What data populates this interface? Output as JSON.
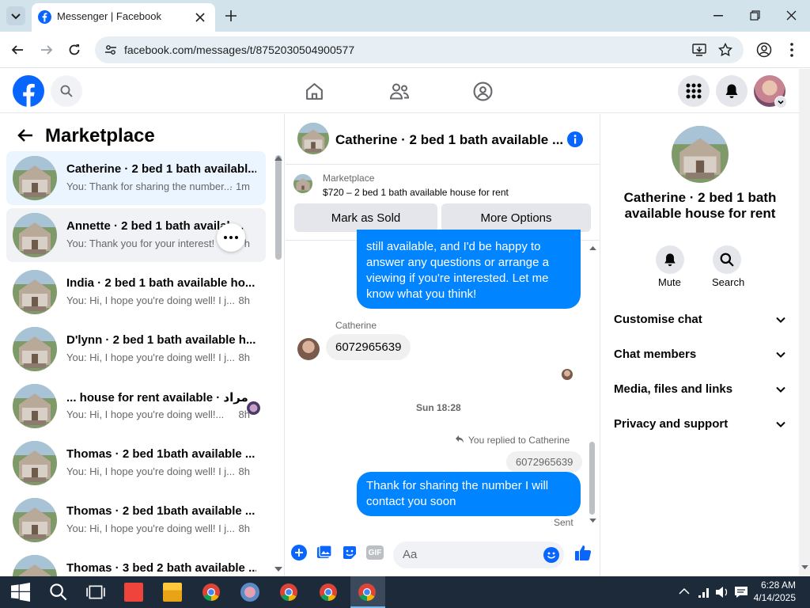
{
  "browser": {
    "tab_title": "Messenger | Facebook",
    "url": "facebook.com/messages/t/8752030504900577"
  },
  "left_panel": {
    "title": "Marketplace",
    "conversations": [
      {
        "name": "Catherine · 2 bed 1 bath availabl...",
        "preview": "You: Thank for sharing the number...",
        "time": "· 1m"
      },
      {
        "name": "Annette · 2 bed 1 bath availab...",
        "preview": "You: Thank you for your interest!",
        "time": "h"
      },
      {
        "name": "India · 2 bed 1 bath available ho...",
        "preview": "You: Hi, I hope you're doing well! I j...",
        "time": "8h"
      },
      {
        "name": "D'lynn · 2 bed 1 bath available h...",
        "preview": "You: Hi, I hope you're doing well! I j...",
        "time": "8h"
      },
      {
        "name": "... house for rent available · مراد",
        "preview": "You: Hi, I hope you're doing well!...",
        "time": "8h"
      },
      {
        "name": "Thomas · 2 bed 1bath available ...",
        "preview": "You: Hi, I hope you're doing well! I j...",
        "time": "8h"
      },
      {
        "name": "Thomas · 2 bed 1bath available ...",
        "preview": "You: Hi, I hope you're doing well! I j...",
        "time": "8h"
      },
      {
        "name": "Thomas · 3 bed 2 bath available ...",
        "preview": "",
        "time": ""
      }
    ]
  },
  "chat": {
    "title": "Catherine · 2 bed 1 bath available ...",
    "marketplace_label": "Marketplace",
    "listing": "$720 – 2 bed 1 bath available house for rent",
    "mark_sold": "Mark as Sold",
    "more_options": "More Options",
    "msg_out_1": "still available, and I'd be happy to answer any questions or arrange a viewing if you're interested. Let me know what you think!",
    "sender_name": "Catherine",
    "msg_in_1": "6072965639",
    "timestamp": "Sun 18:28",
    "replied_label": "You replied to Catherine",
    "quoted": "6072965639",
    "msg_out_2": "Thank for sharing  the number I will contact you soon",
    "status": "Sent",
    "composer_placeholder": "Aa"
  },
  "right_panel": {
    "title": "Catherine · 2 bed 1 bath available house for rent",
    "mute_label": "Mute",
    "search_label": "Search",
    "sections": [
      "Customise chat",
      "Chat members",
      "Media, files and links",
      "Privacy and support"
    ]
  },
  "taskbar": {
    "time": "6:28 AM",
    "date": "4/14/2025"
  },
  "colors": {
    "accent": "#0084ff",
    "fb_blue": "#0866ff"
  }
}
